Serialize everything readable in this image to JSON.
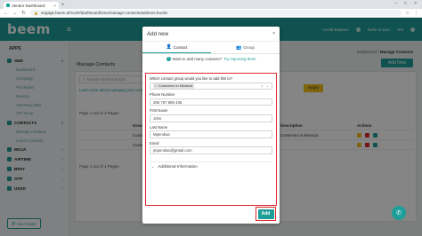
{
  "browser": {
    "tab_title": "Vendor Dashboard",
    "tab_close": "×",
    "new_tab": "+",
    "window_controls": [
      "–",
      "□",
      "×"
    ],
    "nav": [
      "←",
      "→",
      "↻"
    ],
    "url": "engage.beem.africa/#/dashboard/sms/manage-contacts/address-books",
    "right_icons": [
      "☆",
      "⋮"
    ]
  },
  "header": {
    "logo": "beem",
    "menu_icon": "≡",
    "credit_label": "Credit Balance",
    "refer_label": "Refer & Earn",
    "lang": "EN"
  },
  "sidebar": {
    "title": "APPS",
    "sections": [
      {
        "label": "SMS",
        "items": [
          "Dashboard",
          "Campaign",
          "Purchases",
          "Reports",
          "Two-Way SMS",
          "API Setup"
        ]
      },
      {
        "label": "CONTACTS",
        "items": [
          "Manage Contacts",
          "Import Contacts"
        ]
      },
      {
        "label": "MOJA",
        "items": []
      },
      {
        "label": "AIRTIME",
        "items": []
      },
      {
        "label": "BPAY",
        "items": []
      },
      {
        "label": "OTP",
        "items": []
      },
      {
        "label": "USSD",
        "items": []
      }
    ],
    "user_guide": "User Guide"
  },
  "main": {
    "title": "Manage Contacts",
    "breadcrumb_parent": "Dashboard",
    "breadcrumb_sep": "/",
    "breadcrumb_current": "Manage Contacts",
    "add_new": "Add New",
    "filter_placeholder": "Search Address Books",
    "info_text": "Learn more about managing your contacts",
    "apply": "Apply",
    "pager_top": "Page 1 out of 1 Pages",
    "pager_bottom": "Page 1 out of 1 Pages",
    "table": {
      "headers": [
        "Group",
        "Description",
        "Actions"
      ],
      "rows": [
        {
          "group": "Customers",
          "desc": "Customers in Mwanza"
        },
        {
          "group": "Customers",
          "desc": ""
        }
      ]
    }
  },
  "modal": {
    "title": "Add new",
    "close": "×",
    "tabs": [
      {
        "label": "Contact",
        "icon": "person-icon"
      },
      {
        "label": "Group",
        "icon": "group-icon"
      }
    ],
    "notice_text": "Want to add many contacts?",
    "notice_link": "Try importing them",
    "group_label": "Which contact group would you like to add this to?",
    "group_chip": "Customers in Mwanza",
    "phone_label": "Phone Number",
    "phone_value": "255 767 885 435",
    "firstname_label": "First Name",
    "firstname_value": "John",
    "lastname_label": "Last Name",
    "lastname_value": "Mpendwa",
    "email_label": "Email",
    "email_value": "jmpendwa@gmail.com",
    "additional_info": "Additional Information",
    "add_button": "Add"
  },
  "colors": {
    "brand": "#1d9e98",
    "highlight": "#e0282c",
    "apply": "#f1c21a"
  }
}
